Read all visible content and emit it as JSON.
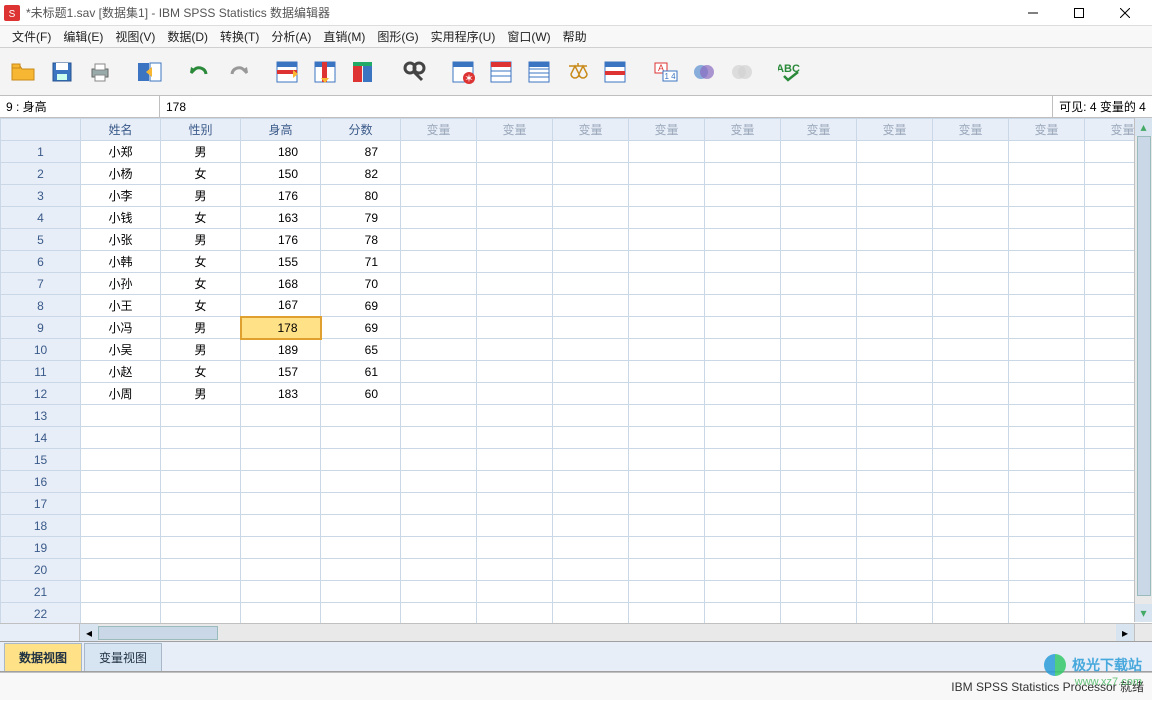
{
  "title": "*未标题1.sav [数据集1] - IBM SPSS Statistics 数据编辑器",
  "menus": [
    "文件(F)",
    "编辑(E)",
    "视图(V)",
    "数据(D)",
    "转换(T)",
    "分析(A)",
    "直销(M)",
    "图形(G)",
    "实用程序(U)",
    "窗口(W)",
    "帮助"
  ],
  "cell_ref": "9 : 身高",
  "cell_val": "178",
  "visible_text": "可见: 4 变量的 4",
  "columns": [
    "姓名",
    "性别",
    "身高",
    "分数"
  ],
  "empty_col_label": "变量",
  "empty_col_count": 12,
  "rows": [
    {
      "n": "1",
      "姓名": "小郑",
      "性别": "男",
      "身高": "180",
      "分数": "87"
    },
    {
      "n": "2",
      "姓名": "小杨",
      "性别": "女",
      "身高": "150",
      "分数": "82"
    },
    {
      "n": "3",
      "姓名": "小李",
      "性别": "男",
      "身高": "176",
      "分数": "80"
    },
    {
      "n": "4",
      "姓名": "小钱",
      "性别": "女",
      "身高": "163",
      "分数": "79"
    },
    {
      "n": "5",
      "姓名": "小张",
      "性别": "男",
      "身高": "176",
      "分数": "78"
    },
    {
      "n": "6",
      "姓名": "小韩",
      "性别": "女",
      "身高": "155",
      "分数": "71"
    },
    {
      "n": "7",
      "姓名": "小孙",
      "性别": "女",
      "身高": "168",
      "分数": "70"
    },
    {
      "n": "8",
      "姓名": "小王",
      "性别": "女",
      "身高": "167",
      "分数": "69"
    },
    {
      "n": "9",
      "姓名": "小冯",
      "性别": "男",
      "身高": "178",
      "分数": "69"
    },
    {
      "n": "10",
      "姓名": "小吴",
      "性别": "男",
      "身高": "189",
      "分数": "65"
    },
    {
      "n": "11",
      "姓名": "小赵",
      "性别": "女",
      "身高": "157",
      "分数": "61"
    },
    {
      "n": "12",
      "姓名": "小周",
      "性别": "男",
      "身高": "183",
      "分数": "60"
    }
  ],
  "empty_rows": [
    "13",
    "14",
    "15",
    "16",
    "17",
    "18",
    "19",
    "20",
    "21",
    "22"
  ],
  "selected": {
    "row": 9,
    "col": "身高"
  },
  "tabs": {
    "data": "数据视图",
    "var": "变量视图",
    "active": "data"
  },
  "status": "IBM SPSS Statistics Processor 就绪",
  "watermark": {
    "brand": "极光下载站",
    "url": "www.xz7.com"
  },
  "toolbar_icons": [
    "open",
    "save",
    "print",
    "recall",
    "undo",
    "redo",
    "goto-case",
    "goto-var",
    "variables",
    "find",
    "insert-case",
    "insert-var",
    "split",
    "weight",
    "select",
    "value-labels",
    "use-sets",
    "show-all",
    "spellcheck"
  ]
}
